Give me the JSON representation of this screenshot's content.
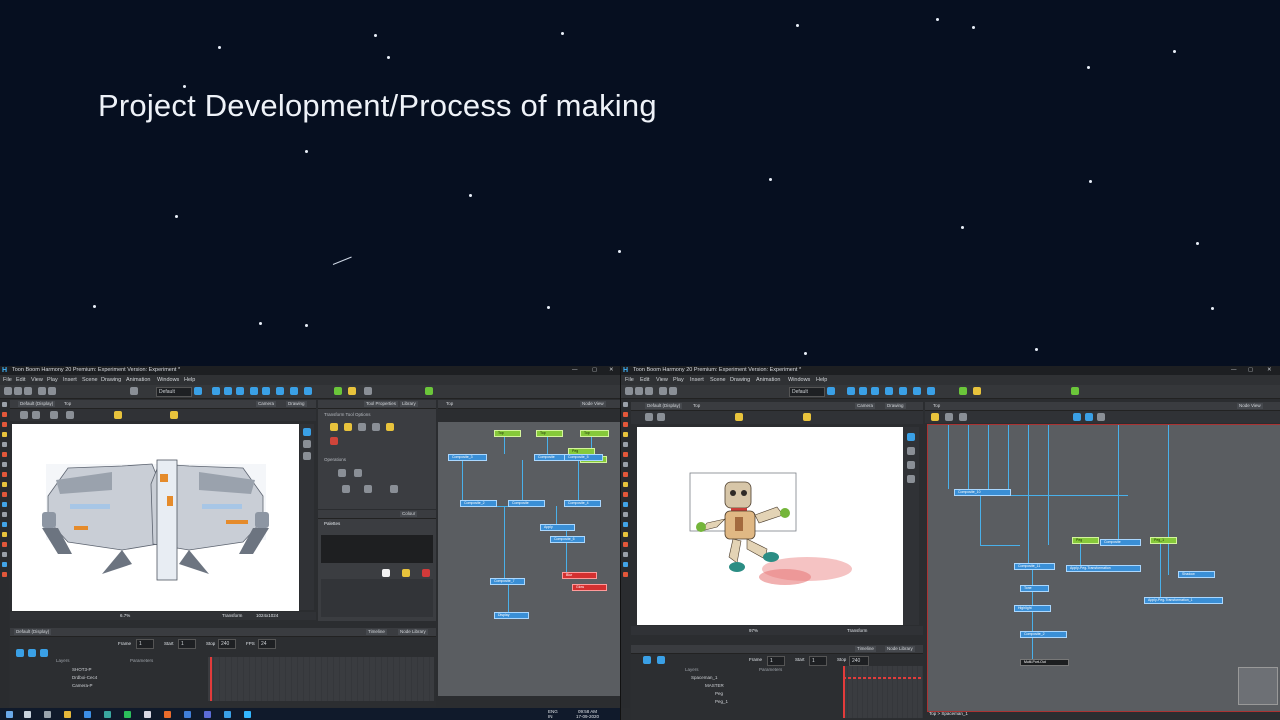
{
  "slide": {
    "title": "Project Development/Process  of making",
    "background": "#060f20"
  },
  "left_window": {
    "title": "Toon Boom Harmony 20 Premium: Experiment Version: Experiment *",
    "menu": [
      "File",
      "Edit",
      "View",
      "Play",
      "Insert",
      "Scene",
      "Drawing",
      "Animation",
      "Windows",
      "Help"
    ],
    "workspace": "Default",
    "tabs": {
      "camera": "Camera",
      "drawing": "Drawing",
      "tool_properties": "Tool Properties",
      "library": "Library",
      "node_view": "Node View",
      "colour": "Colour",
      "timeline": "Timeline",
      "node_library": "Node Library"
    },
    "tool_options": "Transform Tool Options",
    "operations": "Operations",
    "palette": "Palettes",
    "display": "Default (Display)",
    "top_label": "Top",
    "zoom": "6.7%",
    "status": {
      "mode": "Transform",
      "resolution": "1024x1024"
    },
    "timeline": {
      "frame_label": "Frame",
      "frame": "1",
      "start_label": "Start",
      "start": "1",
      "stop_label": "Stop",
      "stop": "240",
      "fps_label": "FPS",
      "fps": "24"
    },
    "layers_header": "Layers",
    "parameters_header": "Parameters",
    "layers": [
      "SHOT3-P",
      "Drdboi-Cec4",
      "Camera-P"
    ],
    "nodes": [
      {
        "label": "Top",
        "kind": "g"
      },
      {
        "label": "Top",
        "kind": "g"
      },
      {
        "label": "Top",
        "kind": "g"
      },
      {
        "label": "Peg",
        "kind": "g"
      },
      {
        "label": "Peg",
        "kind": "g"
      },
      {
        "label": "Composite_3",
        "kind": "b"
      },
      {
        "label": "Composite",
        "kind": "b"
      },
      {
        "label": "Composite_5",
        "kind": "b"
      },
      {
        "label": "Composite_2",
        "kind": "b"
      },
      {
        "label": "Composite",
        "kind": "b"
      },
      {
        "label": "Composite_4",
        "kind": "b"
      },
      {
        "label": "Apply",
        "kind": "b"
      },
      {
        "label": "Composite_6",
        "kind": "b"
      },
      {
        "label": "Composite_7",
        "kind": "b"
      },
      {
        "label": "Blur",
        "kind": "r"
      },
      {
        "label": "Glow",
        "kind": "r"
      },
      {
        "label": "Display",
        "kind": "b"
      }
    ]
  },
  "right_window": {
    "title": "Toon Boom Harmony 20 Premium: Experiment Version: Experiment *",
    "menu": [
      "File",
      "Edit",
      "View",
      "Play",
      "Insert",
      "Scene",
      "Drawing",
      "Animation",
      "Windows",
      "Help"
    ],
    "workspace": "Default",
    "display": "Default (Display)",
    "top_label": "Top",
    "tabs": {
      "camera": "Camera",
      "drawing": "Drawing",
      "node_view": "Node View",
      "timeline": "Timeline",
      "node_library": "Node Library"
    },
    "zoom": "97%",
    "status": {
      "mode": "Transform"
    },
    "timeline": {
      "frame_label": "Frame",
      "frame": "1",
      "start_label": "Start",
      "start": "1",
      "stop_label": "Stop",
      "stop": "240"
    },
    "layers_header": "Layers",
    "parameters_header": "Parameters",
    "layers": [
      "Spaceman_1",
      "MASTER",
      "Peg",
      "Peg_1"
    ],
    "breadcrumb": "Top > Spaceman_1",
    "nodes": [
      {
        "label": "Composite_10",
        "kind": "b"
      },
      {
        "label": "Composite_11",
        "kind": "b"
      },
      {
        "label": "Peg",
        "kind": "g"
      },
      {
        "label": "Peg_1",
        "kind": "g"
      },
      {
        "label": "Composite",
        "kind": "b"
      },
      {
        "label": "Apply-Peg-Transformation",
        "kind": "b"
      },
      {
        "label": "Shadow",
        "kind": "b"
      },
      {
        "label": "Tone",
        "kind": "b"
      },
      {
        "label": "Highlight",
        "kind": "b"
      },
      {
        "label": "Apply-Peg-Transformation_1",
        "kind": "b"
      },
      {
        "label": "Composite_2",
        "kind": "b"
      },
      {
        "label": "Multi-Port-Out",
        "kind": "y"
      }
    ]
  },
  "taskbar": {
    "language": "ENG",
    "region": "IN",
    "time": "09:58 AM",
    "date": "17-09-2020"
  },
  "colors": {
    "node_blue": "#3a8fd6",
    "node_green": "#86c93a",
    "node_red": "#d43030",
    "wire": "#49b0ea"
  }
}
